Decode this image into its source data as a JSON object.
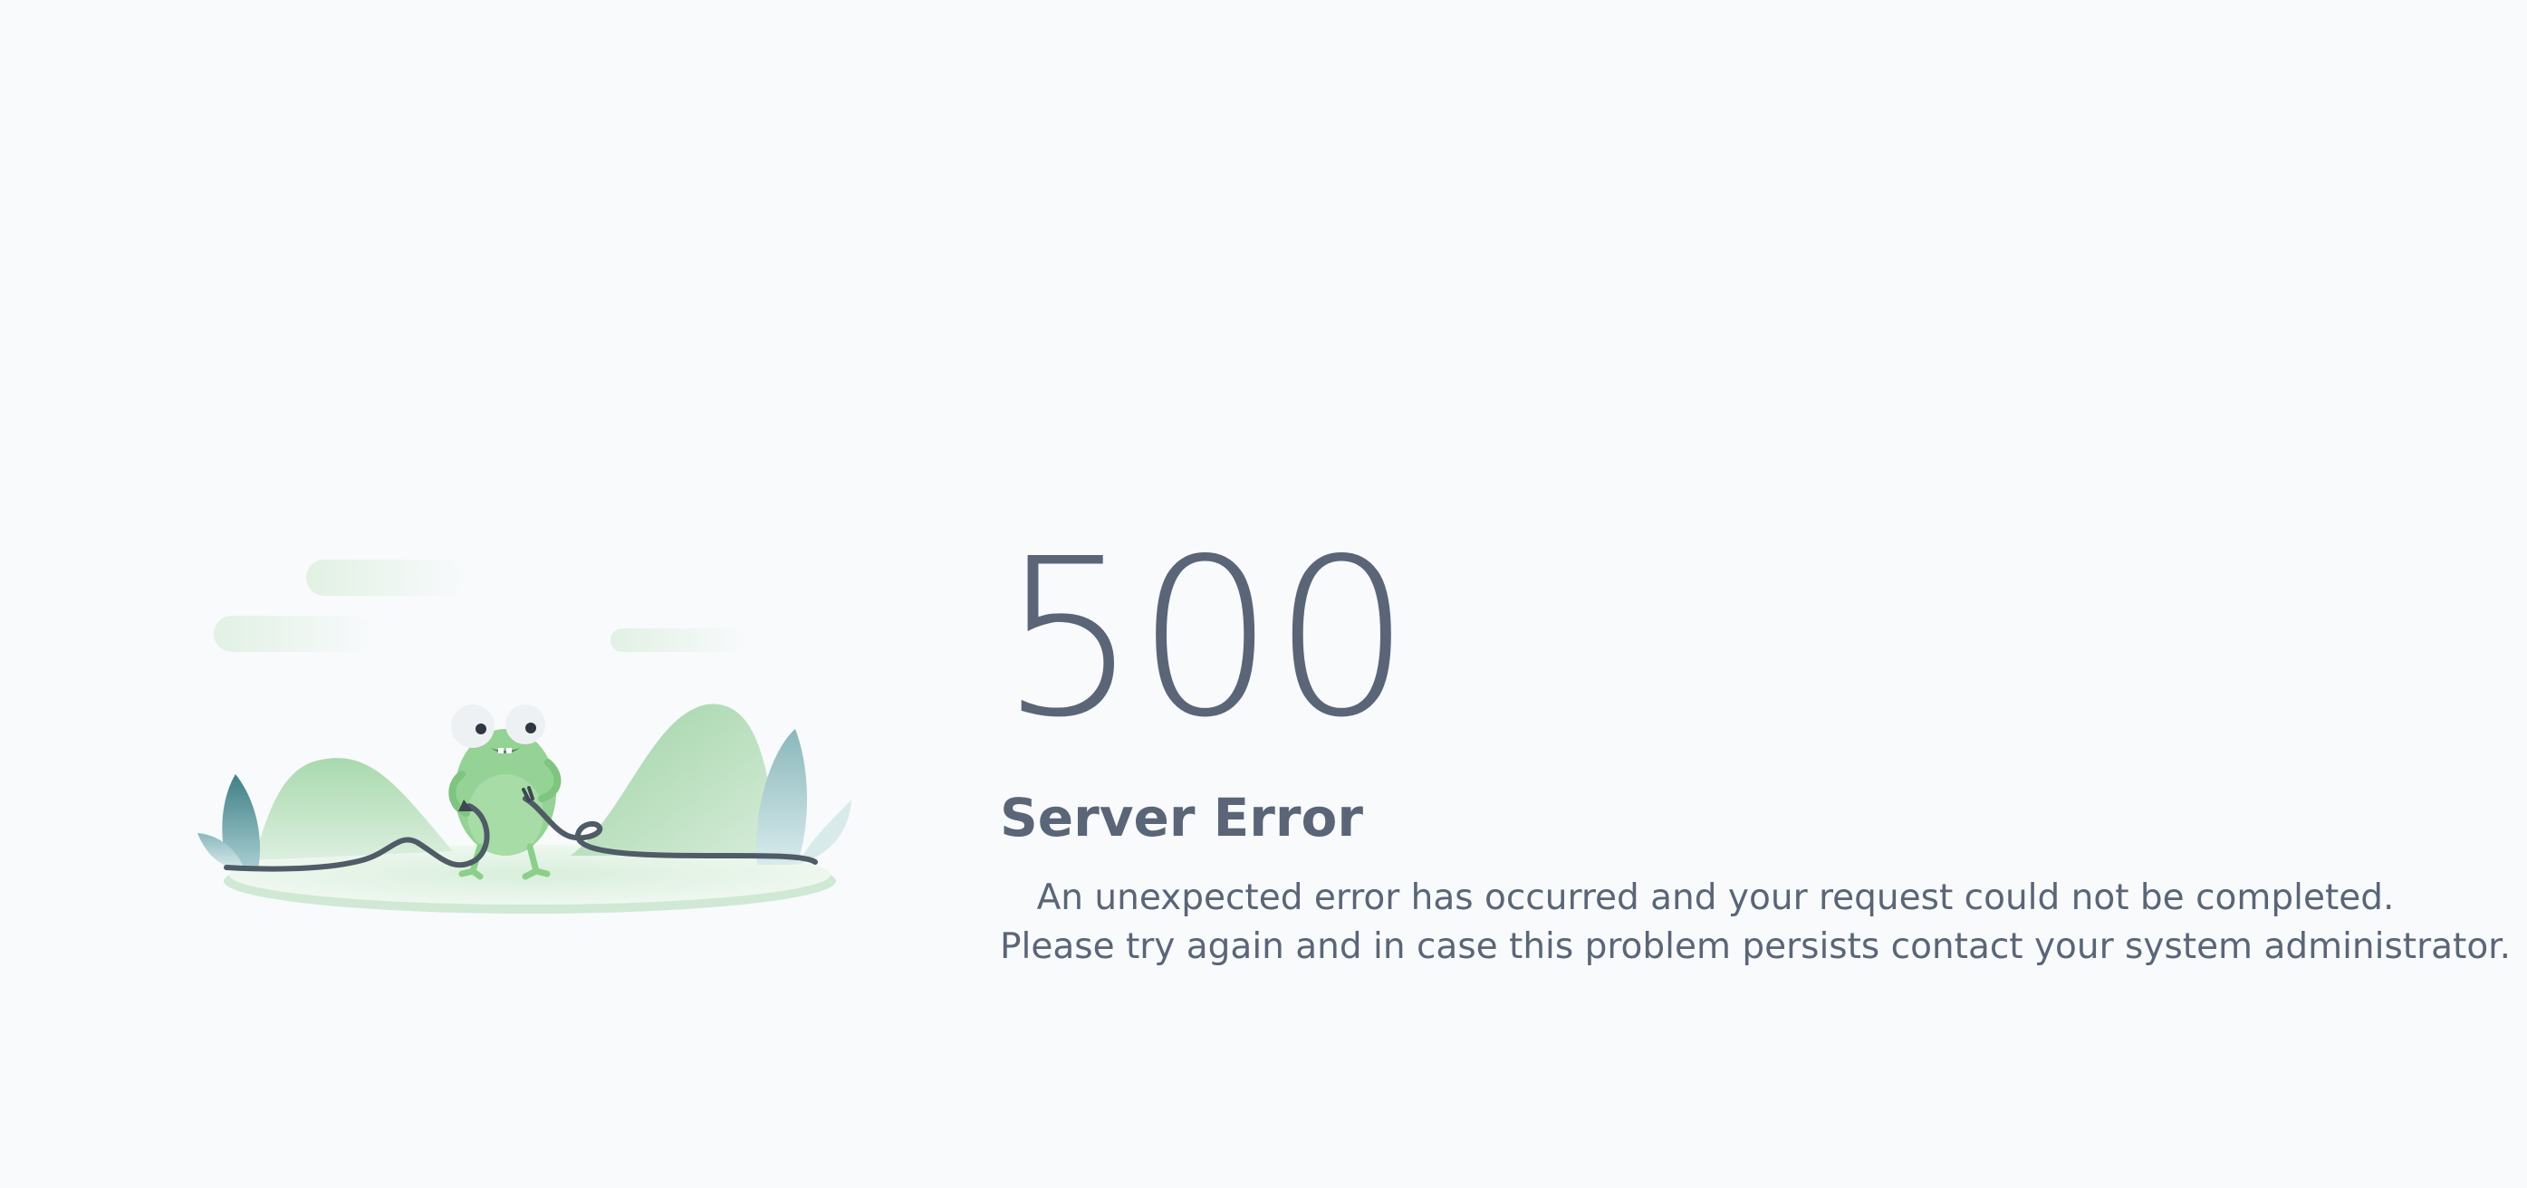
{
  "error": {
    "code": "500",
    "title": "Server Error",
    "message_line1": "An unexpected error has occurred and your request could not be completed.",
    "message_line2": "Please try again and in case this problem persists contact your system administrator."
  },
  "illustration": {
    "icon": "frog-unplugged-cable-illustration",
    "colors": {
      "frog": "#8ccf8a",
      "hills": "#bfe3c3",
      "leaves": "#6f9ea3",
      "cable": "#4f5b66",
      "pad": "#e6f3e9"
    }
  },
  "colors": {
    "background": "#f8fafc",
    "text": "#5a6577"
  }
}
